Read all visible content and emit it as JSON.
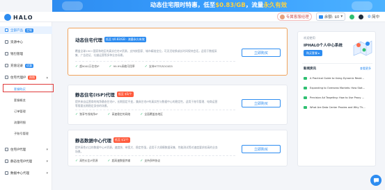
{
  "banner": {
    "text_pre": "动态住宅限时特惠，低至",
    "price": "$0.83/GB",
    "text_mid": "，流量",
    "highlight": "永久有效"
  },
  "header": {
    "logo": "HALO",
    "service_label": "专属客服经理",
    "balance_prefix": "余额: $0",
    "language": "简中"
  },
  "sidebar": {
    "items": [
      {
        "label": "全部产品",
        "badge": "定制"
      },
      {
        "label": "资源中心"
      },
      {
        "label": "钱包管理"
      },
      {
        "label": "充值记录",
        "badge": "优惠"
      },
      {
        "label": "住宅代理IP",
        "badge": "热销"
      },
      {
        "label": "住宅IP代理"
      },
      {
        "label": "静态住宅IP代理"
      },
      {
        "label": "数据中心代理"
      }
    ],
    "subitems": [
      "套餐购买",
      "套餐概览",
      "订单管理",
      "流量明细",
      "子账号管理"
    ]
  },
  "cards": [
    {
      "title": "动态住宅代理",
      "tag": "低至 $0.83/GB · 流量永久有效",
      "desc": "覆盖全球190+国家和地区的真实住宅IP资源，支持按国家、城市精准定位，可灵活轮换或长时间保持会话，适用于数据采集、广告验证、社媒运营等多种业务场景。",
      "features": [
        "超9000万住宅IP",
        "99.9%网络可用率",
        "支持HTTP/SOCKS5"
      ],
      "button": "立即购买"
    },
    {
      "title": "静态住宅(ISP)代理",
      "tag": "低至 $5/个",
      "desc": "提供来自运营商的纯净静态住宅IP，长期固定不变，兼具住宅IP的真实性与数据中心的稳定性，适用于账号管理、电商运营等需要长期稳定身份的场景。",
      "features": [
        "独享专线纯净IP",
        "高速稳定的网络",
        "全面覆盖各地区"
      ],
      "button": "立即购买"
    },
    {
      "title": "静态数据中心代理",
      "tag": "低至 $1/个",
      "desc": "提供高性价比的数据中心IP资源，速度快、带宽大、稳定性强，适用于大规模数据采集、性能测试等对速度要求较高的业务场景。",
      "features": [
        "高性价比IP资源",
        "超高速数据传输",
        "支持多种协议"
      ],
      "button": "立即购买"
    }
  ],
  "right_panel": {
    "lead": "欢迎使用",
    "title": "IPHALO个人中心系统",
    "button": "购买套餐 ▸",
    "news_title": "新闻资讯",
    "news_more": "查看更多",
    "news": [
      "A Practical Guide to Using Dynamic Resid...",
      "Expanding to Overseas Markets: How Stat...",
      "Precision Ad Targeting: How to Use Proxy ...",
      "What Are Data Center Proxies and Why Th..."
    ]
  },
  "colors": {
    "primary": "#2d8cf0",
    "highlight": "#ffd23f",
    "danger": "#e03a3a",
    "success": "#2fbf71"
  }
}
